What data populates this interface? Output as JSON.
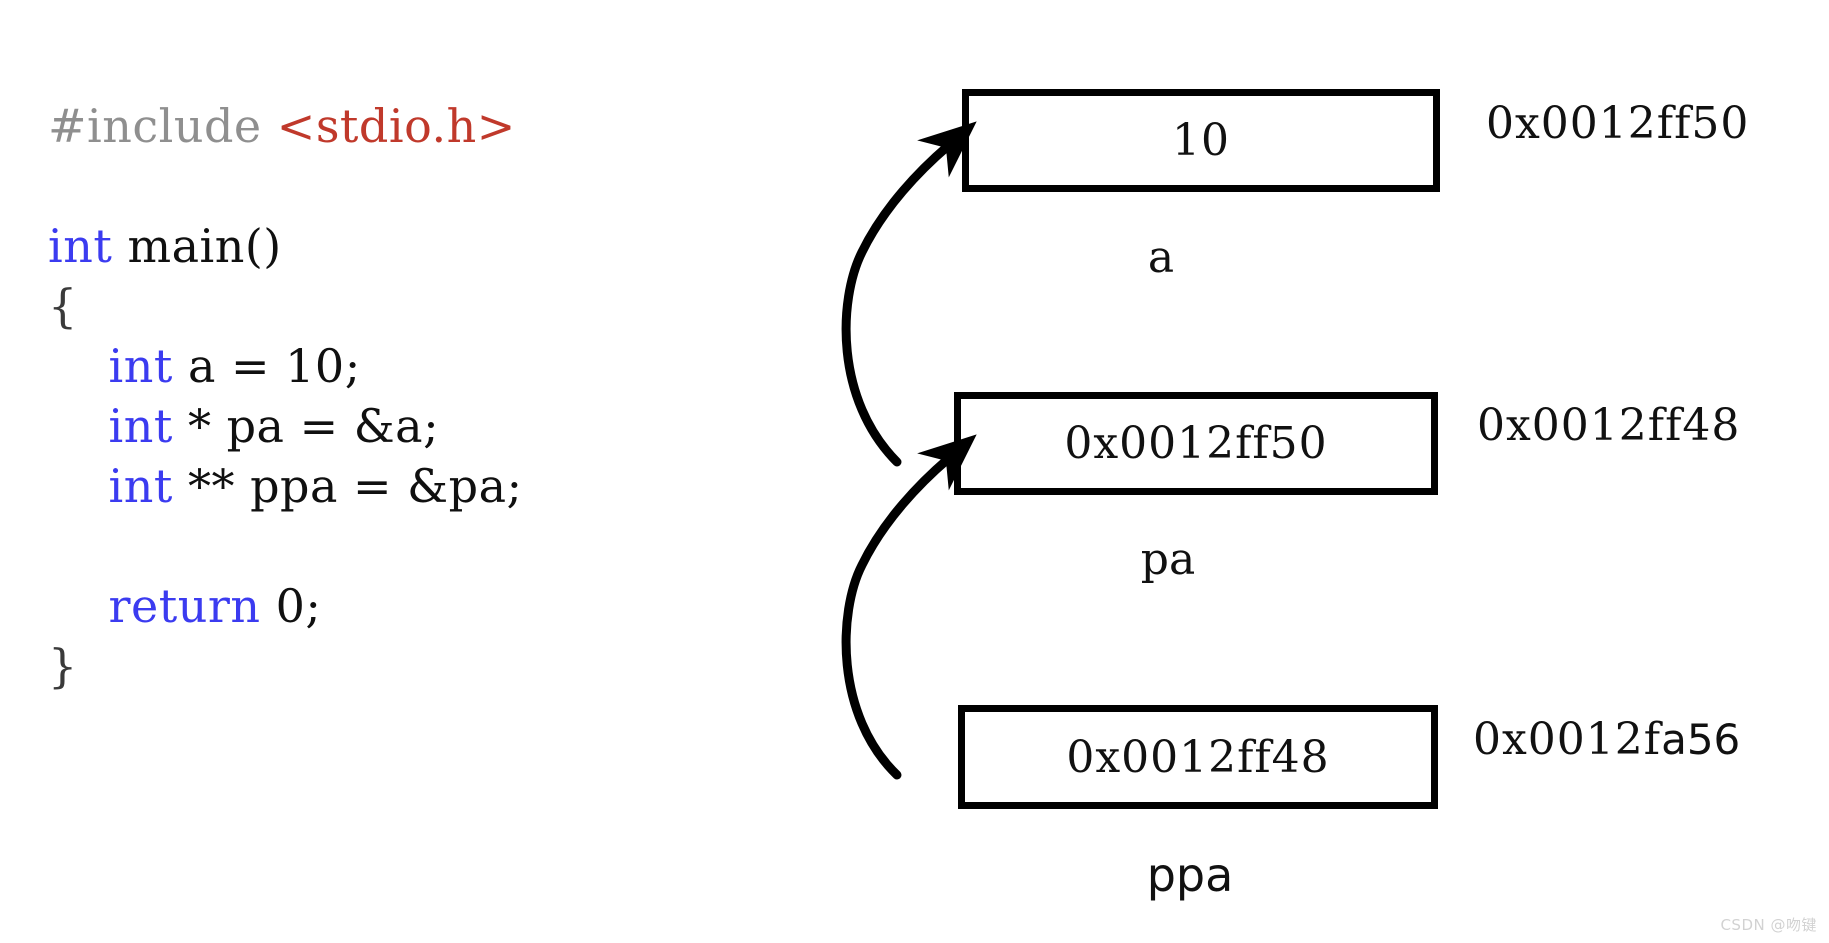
{
  "code": {
    "lines": [
      {
        "id": "include",
        "parts": [
          {
            "text": "#include ",
            "style": "pre"
          },
          {
            "text": "<stdio.h>",
            "style": "hdr"
          }
        ]
      },
      {
        "id": "blank1",
        "parts": []
      },
      {
        "id": "main",
        "parts": [
          {
            "text": "int",
            "style": "kw"
          },
          {
            "text": " main()",
            "style": "plain"
          }
        ]
      },
      {
        "id": "open-brace",
        "parts": [
          {
            "text": "{",
            "style": "punct"
          }
        ]
      },
      {
        "id": "decl-a",
        "parts": [
          {
            "text": "    ",
            "style": "plain"
          },
          {
            "text": "int",
            "style": "kw"
          },
          {
            "text": " a = 10;",
            "style": "plain"
          }
        ]
      },
      {
        "id": "decl-pa",
        "parts": [
          {
            "text": "    ",
            "style": "plain"
          },
          {
            "text": "int",
            "style": "kw"
          },
          {
            "text": " * pa = &a;",
            "style": "plain"
          }
        ]
      },
      {
        "id": "decl-ppa",
        "parts": [
          {
            "text": "    ",
            "style": "plain"
          },
          {
            "text": "int",
            "style": "kw"
          },
          {
            "text": " ** ppa = &pa;",
            "style": "plain"
          }
        ]
      },
      {
        "id": "blank2",
        "parts": []
      },
      {
        "id": "return",
        "parts": [
          {
            "text": "    ",
            "style": "plain"
          },
          {
            "text": "return",
            "style": "kw"
          },
          {
            "text": " 0;",
            "style": "plain"
          }
        ]
      },
      {
        "id": "close-brace",
        "parts": [
          {
            "text": "}",
            "style": "punct"
          }
        ]
      }
    ]
  },
  "memory": {
    "cells": [
      {
        "id": "cell-a",
        "value": "10",
        "address": "0x0012ff50",
        "address_alt": "",
        "name": "a",
        "name_font": "serif"
      },
      {
        "id": "cell-pa",
        "value": "0x0012ff50",
        "address": "0x0012ff48",
        "address_alt": "",
        "name": "pa",
        "name_font": "serif"
      },
      {
        "id": "cell-ppa",
        "value": "0x0012ff48",
        "address": "0x0012f",
        "address_alt": "a56",
        "name": "ppa",
        "name_font": "sans"
      }
    ]
  },
  "arrows": [
    {
      "id": "arrow-pa-to-a",
      "from_label": "pa",
      "to_label": "a"
    },
    {
      "id": "arrow-ppa-to-pa",
      "from_label": "ppa",
      "to_label": "pa"
    }
  ],
  "watermark": {
    "text": "CSDN @吻键"
  },
  "colors": {
    "preprocessor": "#8f8f8f",
    "header": "#c0392b",
    "keyword": "#3b3bf0",
    "text": "#101010",
    "box_border": "#000000",
    "arrow": "#000000",
    "watermark": "#d2d2d2"
  }
}
